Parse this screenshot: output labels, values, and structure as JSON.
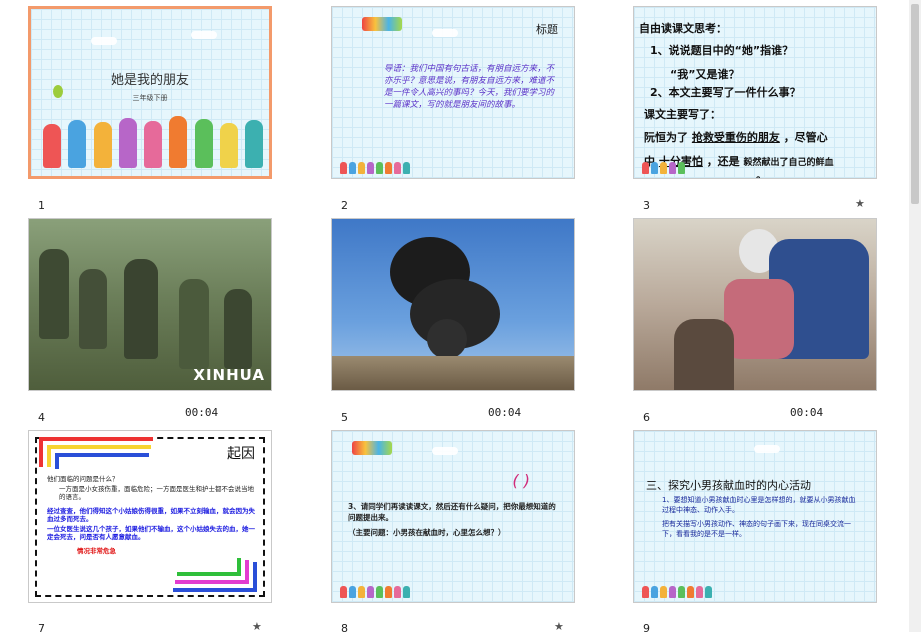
{
  "slides": [
    {
      "number": "1",
      "title": "她是我的朋友",
      "subtitle": "三年级下册"
    },
    {
      "number": "2",
      "label": "标题",
      "text": "导语：我们中国有句古话，有朋自远方来，不亦乐乎？意思是说，有朋友自远方来，难道不是一件令人高兴的事吗？今天，我们要学习的一篇课文，写的就是朋友间的故事。"
    },
    {
      "number": "3",
      "lines": [
        "自由读课文思考：",
        "1、说说题目中的“她”指谁？",
        "“我”又是谁？",
        "2、本文主要写了一件什么事？",
        "课文主要写了：",
        "阮恒为了",
        "抢救受重伤的朋友",
        "，尽管心",
        "中",
        "十分害怕",
        "，还是",
        "毅然献出了自己的鲜血",
        "。"
      ]
    },
    {
      "number": "4",
      "duration": "00:04",
      "watermark": "XINHUA"
    },
    {
      "number": "5",
      "duration": "00:04"
    },
    {
      "number": "6",
      "duration": "00:04"
    },
    {
      "number": "7",
      "label": "起因",
      "q": "他们面临的问题是什么？",
      "a": "一方面是小女孩伤重，面临危险；一方面是医生和护士都不会说当地的语言。",
      "b": "经过查查，他们得知这个小姑娘伤得很重，如果不立刻输血，就会因为失血过多而死去。",
      "c": "一位女医生说这几个孩子，如果他们不输血，这个小姑娘失去的血，她一定会死去，问是否有人愿意献血。",
      "d": "情况非常危急"
    },
    {
      "number": "8",
      "mark": "( )",
      "p1": "3、请同学们再读读课文，然后还有什么疑问，把你最想知道的问题提出来。",
      "p2": "（主要问题：小男孩在献血时，心里怎么想？）"
    },
    {
      "number": "9",
      "heading": "三、探究小男孩献血时的内心活动",
      "p1": "1、要想知道小男孩献血时心里是怎样想的，就要从小男孩献血过程中神态、动作入手。",
      "p2": "把有关描写小男孩动作、神态的句子画下来，现在同桌交流一下，看看我的是不是一样。"
    }
  ]
}
